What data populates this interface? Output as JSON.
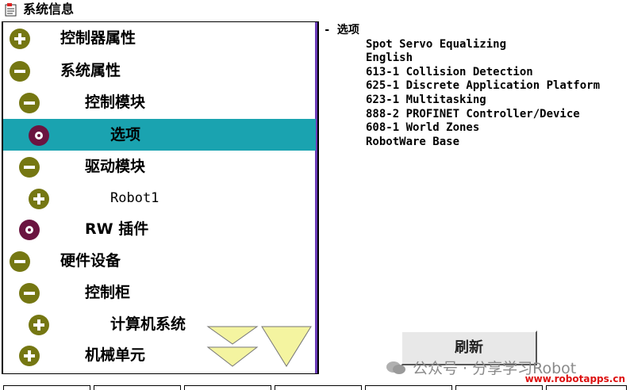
{
  "window": {
    "title": "系统信息",
    "icon": "system-info-icon"
  },
  "tree": {
    "items": [
      {
        "label": "控制器属性",
        "icon": "plus",
        "indent": 0,
        "selected": false
      },
      {
        "label": "系统属性",
        "icon": "minus",
        "indent": 0,
        "selected": false
      },
      {
        "label": "控制模块",
        "icon": "minus",
        "indent": 1,
        "selected": false
      },
      {
        "label": "选项",
        "icon": "dot",
        "indent": 2,
        "selected": true
      },
      {
        "label": "驱动模块",
        "icon": "minus",
        "indent": 1,
        "selected": false
      },
      {
        "label": "Robot1",
        "icon": "plus",
        "indent": 2,
        "selected": false
      },
      {
        "label": "RW 插件",
        "icon": "dot",
        "indent": 1,
        "selected": false
      },
      {
        "label": "硬件设备",
        "icon": "minus",
        "indent": 0,
        "selected": false
      },
      {
        "label": "控制柜",
        "icon": "minus",
        "indent": 1,
        "selected": false
      },
      {
        "label": "计算机系统",
        "icon": "plus",
        "indent": 2,
        "selected": false
      },
      {
        "label": "机械单元",
        "icon": "plus",
        "indent": 1,
        "selected": false
      }
    ]
  },
  "details": {
    "header": "- 选项",
    "options": [
      "Spot Servo Equalizing",
      "English",
      "613-1 Collision Detection",
      "625-1 Discrete Application Platform",
      "623-1 Multitasking",
      "888-2 PROFINET Controller/Device",
      "608-1 World Zones",
      "RobotWare Base"
    ]
  },
  "buttons": {
    "refresh": "刷新"
  },
  "watermark": {
    "text": "公众号 · 分享学习Robot",
    "url": "www.robotapps.cn"
  },
  "colors": {
    "selected_row": "#1aa3b0",
    "expander": "#757712",
    "leaf_dot": "#6b1440",
    "scrollbar": "#6a3cb8",
    "arrow_fill": "#f4f4a0"
  }
}
